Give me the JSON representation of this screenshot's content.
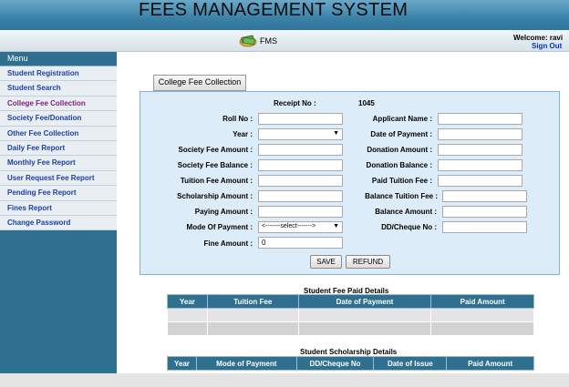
{
  "header": {
    "title": "FEES MANAGEMENT SYSTEM"
  },
  "subbar": {
    "brand": "FMS",
    "welcome": "Welcome: ravi",
    "signout": "Sign Out"
  },
  "sidebar": {
    "menu_label": "Menu",
    "items": [
      {
        "label": "Student Registration",
        "active": false
      },
      {
        "label": "Student Search",
        "active": false
      },
      {
        "label": "College Fee Collection",
        "active": true
      },
      {
        "label": "Society Fee/Donation",
        "active": false
      },
      {
        "label": "Other Fee Collection",
        "active": false
      },
      {
        "label": "Daily Fee Report",
        "active": false
      },
      {
        "label": "Monthly Fee Report",
        "active": false
      },
      {
        "label": "User Request Fee Report",
        "active": false
      },
      {
        "label": "Pending Fee Report",
        "active": false
      },
      {
        "label": "Fines Report",
        "active": false
      },
      {
        "label": "Change Password",
        "active": false
      }
    ]
  },
  "tab": {
    "label": "College Fee Collection"
  },
  "form": {
    "receipt_label": "Receipt No :",
    "receipt_value": "1045",
    "left": {
      "roll_no": "Roll No :",
      "year": "Year :",
      "society_fee_amount": "Society Fee Amount :",
      "society_fee_balance": "Society Fee Balance :",
      "tuition_fee_amount": "Tuition Fee Amount :",
      "scholarship_amount": "Scholarship Amount :",
      "paying_amount": "Paying Amount :",
      "mode_of_payment": "Mode Of Payment :",
      "fine_amount": "Fine Amount :"
    },
    "right": {
      "applicant_name": "Applicant Name :",
      "date_of_payment": "Date of Payment :",
      "donation_amount": "Donation Amount :",
      "donation_balance": "Donation Balance :",
      "paid_tuition_fee": "Paid Tuition Fee :",
      "balance_tuition_fee": "Balance Tuition Fee :",
      "balance_amount": "Balance Amount :",
      "dd_cheque_no": "DD/Cheque No :"
    },
    "year_select_value": "",
    "mode_select_value": "<-------select------->",
    "fine_amount_value": "0",
    "save_label": "SAVE",
    "refund_label": "REFUND"
  },
  "fee_table": {
    "title": "Student Fee Paid Details",
    "columns": [
      "Year",
      "Tuition Fee",
      "Date of Payment",
      "Paid Amount"
    ]
  },
  "scholarship_table": {
    "title": "Student Scholarship Details",
    "columns": [
      "Year",
      "Mode of Payment",
      "DD/Cheque No",
      "Date of Issue",
      "Paid Amount"
    ]
  }
}
